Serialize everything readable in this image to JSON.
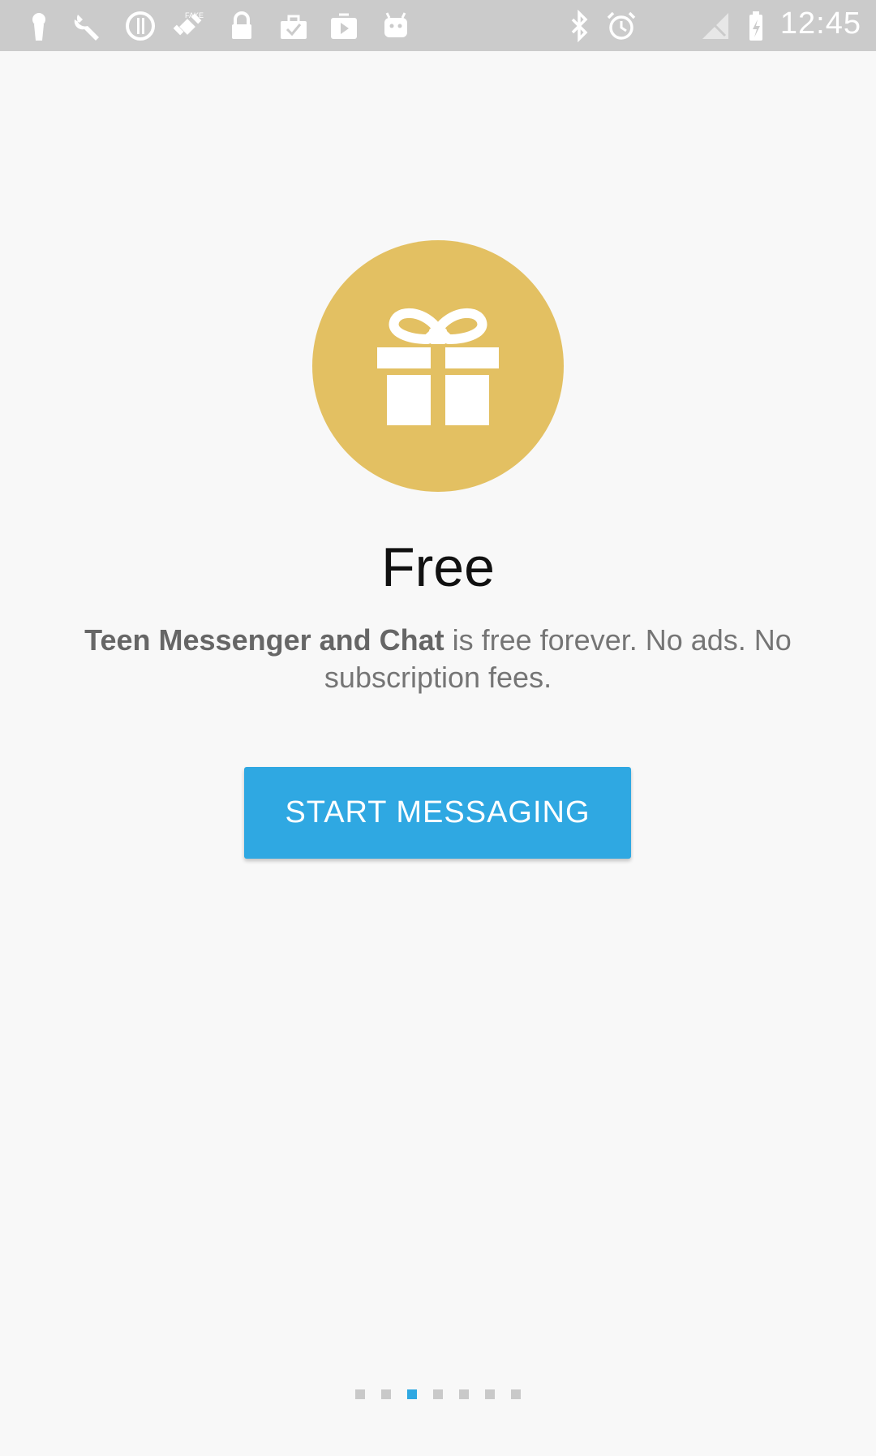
{
  "status_bar": {
    "time": "12:45",
    "left_icons": [
      "keyhole-icon",
      "wrench-icon",
      "info-icon",
      "fake-gps-icon",
      "lock-icon",
      "briefcase-check-icon",
      "play-store-icon",
      "android-icon"
    ],
    "right_icons": [
      "bluetooth-icon",
      "alarm-icon",
      "signal-icon",
      "battery-icon"
    ]
  },
  "onboarding": {
    "icon": "gift-icon",
    "icon_color": "#e3c062",
    "title": "Free",
    "description_bold": "Teen Messenger and Chat",
    "description_rest": " is free forever. No ads. No subscription fees.",
    "button_label": "START MESSAGING",
    "button_color": "#2fa8e2"
  },
  "pager": {
    "total": 7,
    "active_index": 2
  }
}
